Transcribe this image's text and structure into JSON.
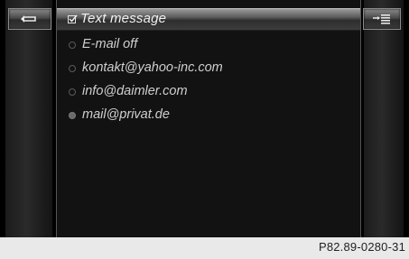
{
  "header": {
    "title": "Text message",
    "icon": "checkbox-icon"
  },
  "sidebar_left": {
    "back_icon": "back-arrow-icon"
  },
  "sidebar_right": {
    "menu_icon": "list-menu-icon"
  },
  "options": [
    {
      "label": "E-mail off",
      "selected": false
    },
    {
      "label": "kontakt@yahoo-inc.com",
      "selected": false
    },
    {
      "label": "info@daimler.com",
      "selected": false
    },
    {
      "label": "mail@privat.de",
      "selected": true
    }
  ],
  "caption": "P82.89-0280-31"
}
